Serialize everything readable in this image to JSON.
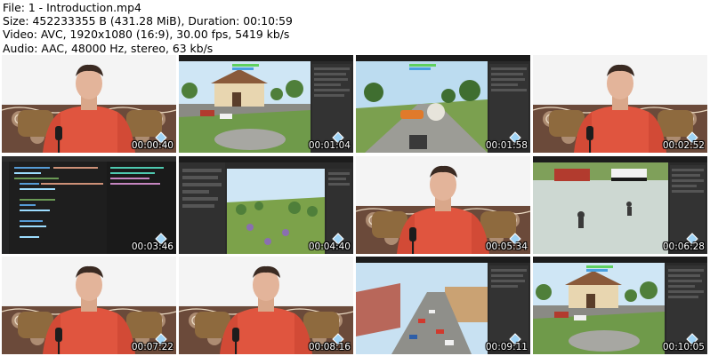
{
  "file_info": {
    "file": "File: 1 - Introduction.mp4",
    "size": "Size: 452233355 B (431.28 MiB), Duration: 00:10:59",
    "video": "Video: AVC, 1920x1080 (16:9), 30.00 fps, 5419 kb/s",
    "audio": "Audio: AAC, 48000 Hz, stereo, 63 kb/s"
  },
  "thumbnails": [
    {
      "timestamp": "00:00:40",
      "scene": "presenter"
    },
    {
      "timestamp": "00:01:04",
      "scene": "game-town-editor"
    },
    {
      "timestamp": "00:01:58",
      "scene": "game-street-editor"
    },
    {
      "timestamp": "00:02:52",
      "scene": "presenter"
    },
    {
      "timestamp": "00:03:46",
      "scene": "code-editor"
    },
    {
      "timestamp": "00:04:40",
      "scene": "terrain-editor"
    },
    {
      "timestamp": "00:05:34",
      "scene": "presenter"
    },
    {
      "timestamp": "00:06:28",
      "scene": "game-police-editor"
    },
    {
      "timestamp": "00:07:22",
      "scene": "presenter"
    },
    {
      "timestamp": "00:08:16",
      "scene": "presenter"
    },
    {
      "timestamp": "00:09:11",
      "scene": "game-city-editor"
    },
    {
      "timestamp": "00:10:05",
      "scene": "game-town-editor"
    }
  ],
  "colors": {
    "shirt": "#e0553f",
    "editor": "#2a2a2a",
    "sky": "#cfe6f5",
    "grass": "#6f9a4a"
  }
}
